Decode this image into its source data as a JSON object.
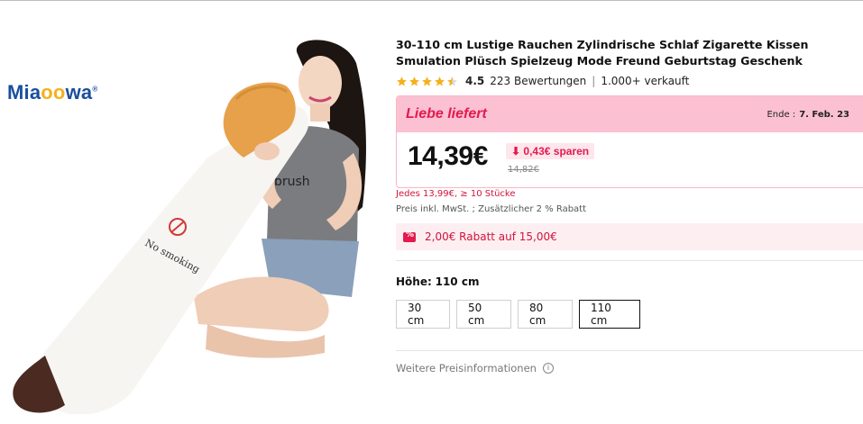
{
  "product": {
    "brand": {
      "prefix": "Mia",
      "oo": "oo",
      "suffix": "wa",
      "reg": "®"
    },
    "image_text": {
      "brush": "brush",
      "no_smoking": "No smoking"
    },
    "title": "30-110 cm Lustige Rauchen Zylindrische Schlaf Zigarette Kissen Smulation Plüsch Spielzeug Mode Freund Geburtstag Geschenk",
    "rating": {
      "value": "4.5",
      "reviews": "223 Bewertungen",
      "separator": "|",
      "sold": "1.000+ verkauft",
      "stars": 4.5
    }
  },
  "deal": {
    "brand_label": "Liebe liefert",
    "end_label": "Ende :",
    "end_date": "7. Feb. 23",
    "price": "14,39€",
    "save": "0,43€ sparen",
    "old_price": "14,82€"
  },
  "notes": {
    "bulk": "Jedes 13,99€, ≥ 10 Stücke",
    "tax": "Preis inkl. MwSt. ; Zusätzlicher 2 % Rabatt"
  },
  "coupon": {
    "text": "2,00€ Rabatt auf 15,00€"
  },
  "size_option": {
    "label": "Höhe:",
    "value": "110 cm",
    "options": [
      "30 cm",
      "50 cm",
      "80 cm",
      "110 cm"
    ],
    "selected_index": 3
  },
  "more_info": {
    "label": "Weitere Preisinformationen",
    "icon": "ⓘ"
  },
  "colors": {
    "accent": "#e41a4f",
    "header_bg": "#fbc1d2",
    "star": "#f4b01d"
  }
}
